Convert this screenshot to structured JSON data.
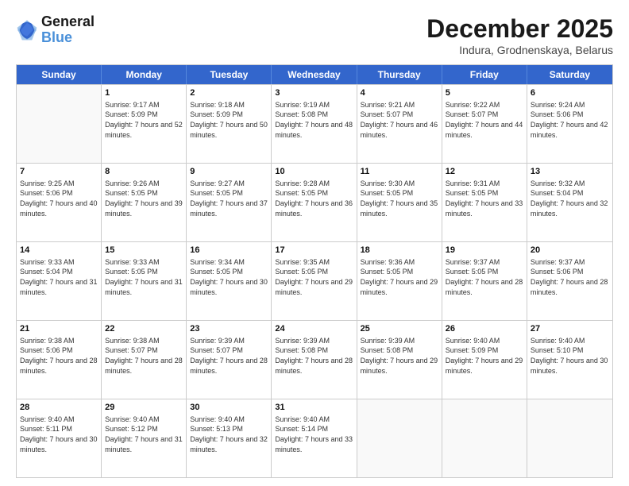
{
  "header": {
    "logo_line1": "General",
    "logo_line2": "Blue",
    "month": "December 2025",
    "location": "Indura, Grodnenskaya, Belarus"
  },
  "days_of_week": [
    "Sunday",
    "Monday",
    "Tuesday",
    "Wednesday",
    "Thursday",
    "Friday",
    "Saturday"
  ],
  "weeks": [
    [
      {
        "day": "",
        "empty": true
      },
      {
        "day": "1",
        "sunrise": "9:17 AM",
        "sunset": "5:09 PM",
        "daylight": "7 hours and 52 minutes."
      },
      {
        "day": "2",
        "sunrise": "9:18 AM",
        "sunset": "5:09 PM",
        "daylight": "7 hours and 50 minutes."
      },
      {
        "day": "3",
        "sunrise": "9:19 AM",
        "sunset": "5:08 PM",
        "daylight": "7 hours and 48 minutes."
      },
      {
        "day": "4",
        "sunrise": "9:21 AM",
        "sunset": "5:07 PM",
        "daylight": "7 hours and 46 minutes."
      },
      {
        "day": "5",
        "sunrise": "9:22 AM",
        "sunset": "5:07 PM",
        "daylight": "7 hours and 44 minutes."
      },
      {
        "day": "6",
        "sunrise": "9:24 AM",
        "sunset": "5:06 PM",
        "daylight": "7 hours and 42 minutes."
      }
    ],
    [
      {
        "day": "7",
        "sunrise": "9:25 AM",
        "sunset": "5:06 PM",
        "daylight": "7 hours and 40 minutes."
      },
      {
        "day": "8",
        "sunrise": "9:26 AM",
        "sunset": "5:05 PM",
        "daylight": "7 hours and 39 minutes."
      },
      {
        "day": "9",
        "sunrise": "9:27 AM",
        "sunset": "5:05 PM",
        "daylight": "7 hours and 37 minutes."
      },
      {
        "day": "10",
        "sunrise": "9:28 AM",
        "sunset": "5:05 PM",
        "daylight": "7 hours and 36 minutes."
      },
      {
        "day": "11",
        "sunrise": "9:30 AM",
        "sunset": "5:05 PM",
        "daylight": "7 hours and 35 minutes."
      },
      {
        "day": "12",
        "sunrise": "9:31 AM",
        "sunset": "5:05 PM",
        "daylight": "7 hours and 33 minutes."
      },
      {
        "day": "13",
        "sunrise": "9:32 AM",
        "sunset": "5:04 PM",
        "daylight": "7 hours and 32 minutes."
      }
    ],
    [
      {
        "day": "14",
        "sunrise": "9:33 AM",
        "sunset": "5:04 PM",
        "daylight": "7 hours and 31 minutes."
      },
      {
        "day": "15",
        "sunrise": "9:33 AM",
        "sunset": "5:05 PM",
        "daylight": "7 hours and 31 minutes."
      },
      {
        "day": "16",
        "sunrise": "9:34 AM",
        "sunset": "5:05 PM",
        "daylight": "7 hours and 30 minutes."
      },
      {
        "day": "17",
        "sunrise": "9:35 AM",
        "sunset": "5:05 PM",
        "daylight": "7 hours and 29 minutes."
      },
      {
        "day": "18",
        "sunrise": "9:36 AM",
        "sunset": "5:05 PM",
        "daylight": "7 hours and 29 minutes."
      },
      {
        "day": "19",
        "sunrise": "9:37 AM",
        "sunset": "5:05 PM",
        "daylight": "7 hours and 28 minutes."
      },
      {
        "day": "20",
        "sunrise": "9:37 AM",
        "sunset": "5:06 PM",
        "daylight": "7 hours and 28 minutes."
      }
    ],
    [
      {
        "day": "21",
        "sunrise": "9:38 AM",
        "sunset": "5:06 PM",
        "daylight": "7 hours and 28 minutes."
      },
      {
        "day": "22",
        "sunrise": "9:38 AM",
        "sunset": "5:07 PM",
        "daylight": "7 hours and 28 minutes."
      },
      {
        "day": "23",
        "sunrise": "9:39 AM",
        "sunset": "5:07 PM",
        "daylight": "7 hours and 28 minutes."
      },
      {
        "day": "24",
        "sunrise": "9:39 AM",
        "sunset": "5:08 PM",
        "daylight": "7 hours and 28 minutes."
      },
      {
        "day": "25",
        "sunrise": "9:39 AM",
        "sunset": "5:08 PM",
        "daylight": "7 hours and 29 minutes."
      },
      {
        "day": "26",
        "sunrise": "9:40 AM",
        "sunset": "5:09 PM",
        "daylight": "7 hours and 29 minutes."
      },
      {
        "day": "27",
        "sunrise": "9:40 AM",
        "sunset": "5:10 PM",
        "daylight": "7 hours and 30 minutes."
      }
    ],
    [
      {
        "day": "28",
        "sunrise": "9:40 AM",
        "sunset": "5:11 PM",
        "daylight": "7 hours and 30 minutes."
      },
      {
        "day": "29",
        "sunrise": "9:40 AM",
        "sunset": "5:12 PM",
        "daylight": "7 hours and 31 minutes."
      },
      {
        "day": "30",
        "sunrise": "9:40 AM",
        "sunset": "5:13 PM",
        "daylight": "7 hours and 32 minutes."
      },
      {
        "day": "31",
        "sunrise": "9:40 AM",
        "sunset": "5:14 PM",
        "daylight": "7 hours and 33 minutes."
      },
      {
        "day": "",
        "empty": true
      },
      {
        "day": "",
        "empty": true
      },
      {
        "day": "",
        "empty": true
      }
    ]
  ]
}
